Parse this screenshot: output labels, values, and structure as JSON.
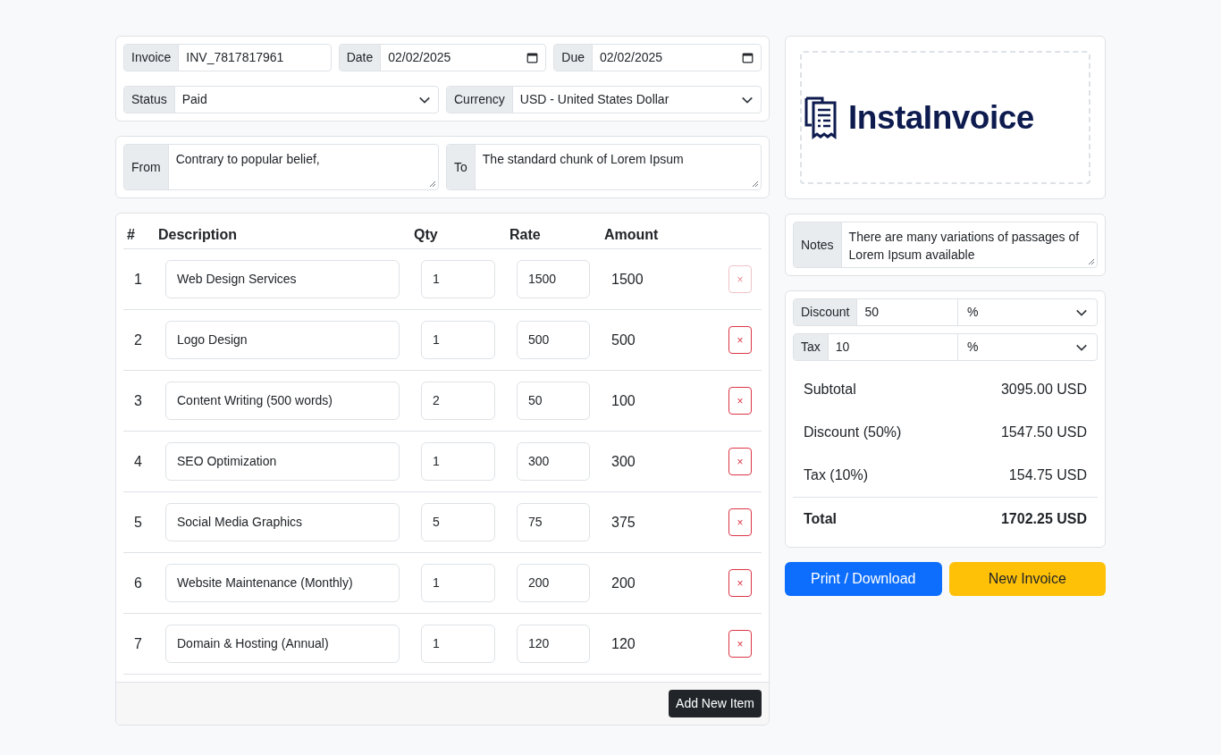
{
  "meta": {
    "invoice": {
      "label": "Invoice",
      "value": "INV_7817817961"
    },
    "date": {
      "label": "Date",
      "value": "02/02/2025"
    },
    "due": {
      "label": "Due",
      "value": "02/02/2025"
    },
    "status": {
      "label": "Status",
      "value": "Paid"
    },
    "currency": {
      "label": "Currency",
      "value": "USD - United States Dollar"
    }
  },
  "parties": [
    {
      "label": "From",
      "value": "Contrary to popular belief,"
    },
    {
      "label": "To",
      "value": "The standard chunk of Lorem Ipsum"
    }
  ],
  "table": {
    "columns": [
      "#",
      "Description",
      "Qty",
      "Rate",
      "Amount"
    ],
    "rows": [
      {
        "index": "1",
        "description": "Web Design Services",
        "qty": "1",
        "rate": "1500",
        "amount": "1500",
        "remove": "×",
        "disabled": true
      },
      {
        "index": "2",
        "description": "Logo Design",
        "qty": "1",
        "rate": "500",
        "amount": "500",
        "remove": "×",
        "disabled": false
      },
      {
        "index": "3",
        "description": "Content Writing (500 words)",
        "qty": "2",
        "rate": "50",
        "amount": "100",
        "remove": "×",
        "disabled": false
      },
      {
        "index": "4",
        "description": "SEO Optimization",
        "qty": "1",
        "rate": "300",
        "amount": "300",
        "remove": "×",
        "disabled": false
      },
      {
        "index": "5",
        "description": "Social Media Graphics",
        "qty": "5",
        "rate": "75",
        "amount": "375",
        "remove": "×",
        "disabled": false
      },
      {
        "index": "6",
        "description": "Website Maintenance (Monthly)",
        "qty": "1",
        "rate": "200",
        "amount": "200",
        "remove": "×",
        "disabled": false
      },
      {
        "index": "7",
        "description": "Domain & Hosting (Annual)",
        "qty": "1",
        "rate": "120",
        "amount": "120",
        "remove": "×",
        "disabled": false
      }
    ],
    "add_button": "Add New Item"
  },
  "logo": {
    "text": "InstaInvoice"
  },
  "notes": {
    "label": "Notes",
    "value": "There are many variations of passages of Lorem Ipsum available"
  },
  "adjustments": [
    {
      "label": "Discount",
      "value": "50",
      "unit": "%"
    },
    {
      "label": "Tax",
      "value": "10",
      "unit": "%"
    }
  ],
  "summary": [
    {
      "label": "Subtotal",
      "value": "3095.00 USD",
      "kind": "line"
    },
    {
      "label": "Discount (50%)",
      "value": "1547.50 USD",
      "kind": "line"
    },
    {
      "label": "Tax (10%)",
      "value": "154.75 USD",
      "kind": "line"
    },
    {
      "label": "Total",
      "value": "1702.25 USD",
      "kind": "total"
    }
  ],
  "actions": [
    {
      "label": "Print / Download",
      "kind": "primary"
    },
    {
      "label": "New Invoice",
      "kind": "warning"
    }
  ]
}
